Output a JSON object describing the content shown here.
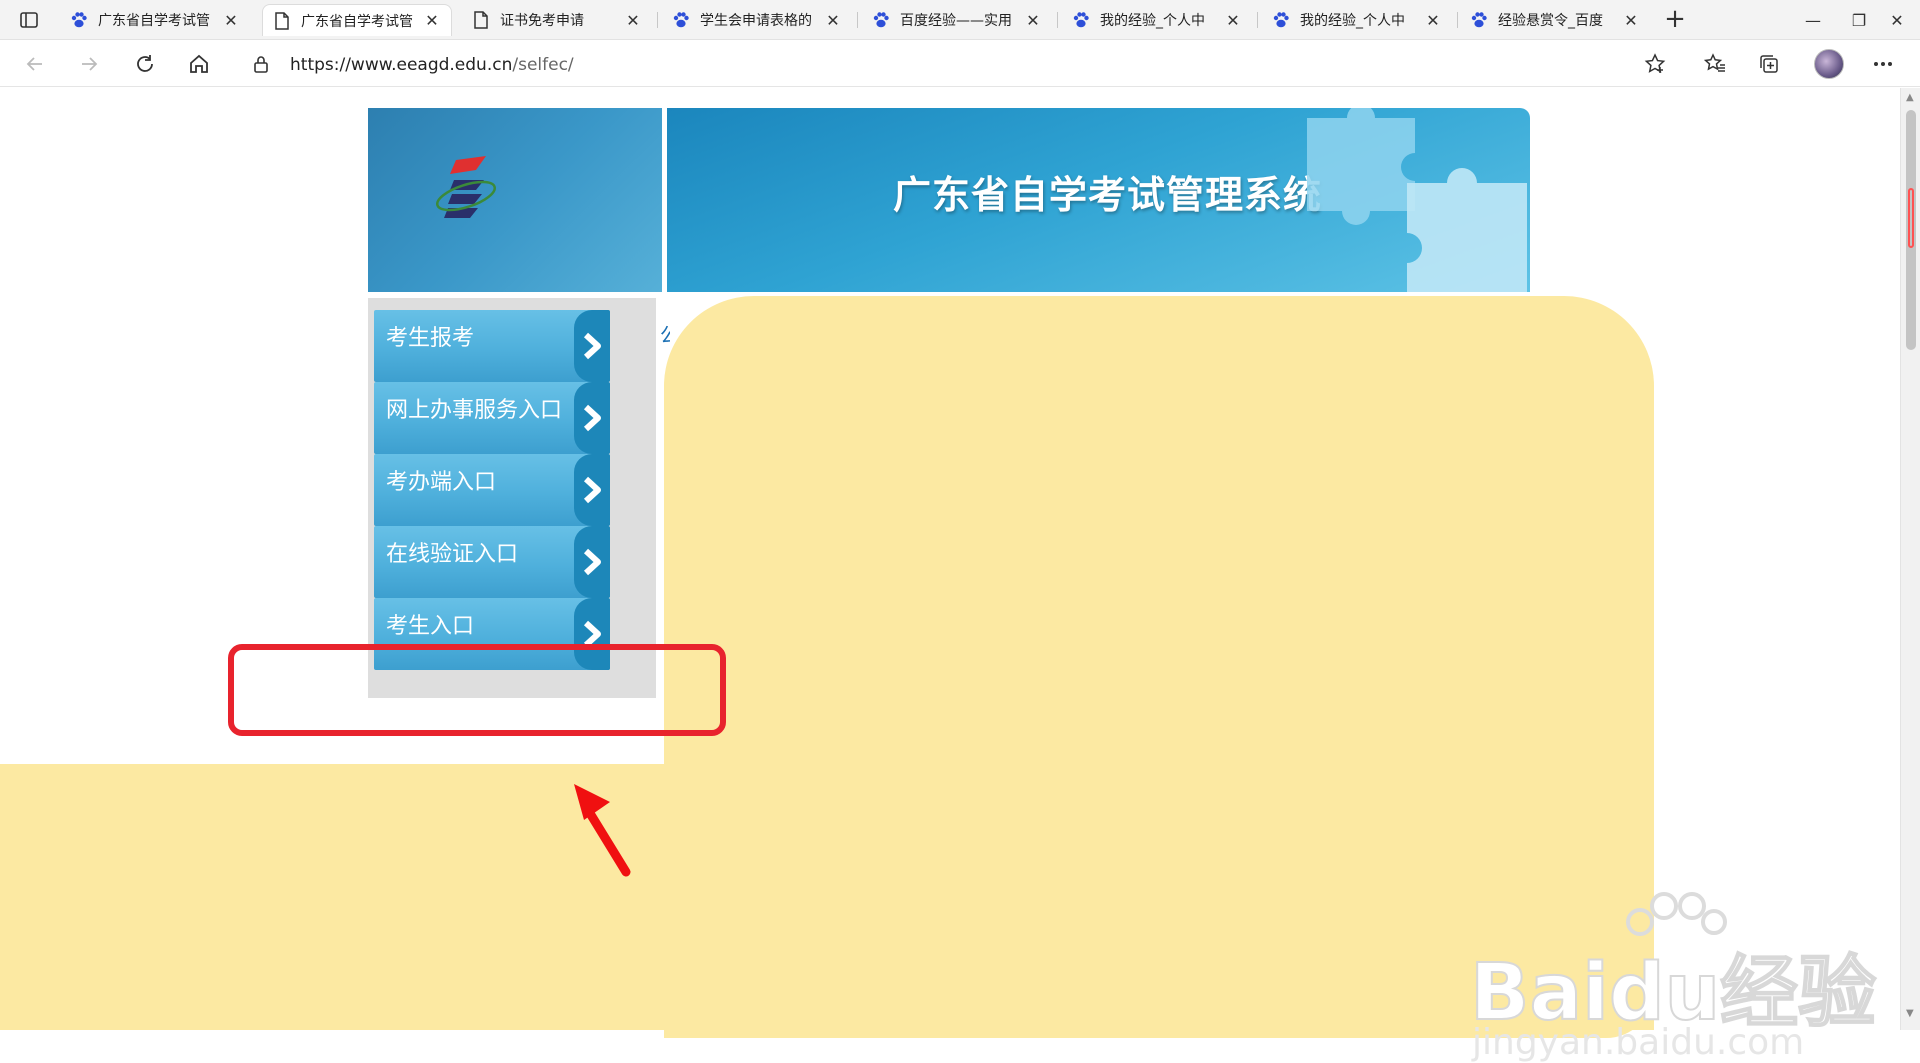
{
  "browser": {
    "tabs": [
      {
        "title": "广东省自学考试管",
        "icon": "baidu-paw-icon",
        "active": false
      },
      {
        "title": "广东省自学考试管",
        "icon": "page-icon",
        "active": true
      },
      {
        "title": "证书免考申请",
        "icon": "page-icon",
        "active": false
      },
      {
        "title": "学生会申请表格的",
        "icon": "baidu-paw-icon",
        "active": false
      },
      {
        "title": "百度经验——实用",
        "icon": "baidu-paw-icon",
        "active": false
      },
      {
        "title": "我的经验_个人中",
        "icon": "baidu-paw-icon",
        "active": false
      },
      {
        "title": "我的经验_个人中",
        "icon": "baidu-paw-icon",
        "active": false
      },
      {
        "title": "经验悬赏令_百度",
        "icon": "baidu-paw-icon",
        "active": false
      }
    ],
    "new_tab": "+",
    "window": {
      "minimize": "—",
      "restore": "❐",
      "close": "✕"
    },
    "address": {
      "host": "https://www.eeagd.edu.cn",
      "path": "/selfec/"
    }
  },
  "site": {
    "title": "广东省自学考试管理系统",
    "menu": [
      {
        "label": "考生报考"
      },
      {
        "label": "网上办事服务入口"
      },
      {
        "label": "考办端入口"
      },
      {
        "label": "在线验证入口"
      },
      {
        "label": "考生入口"
      }
    ]
  },
  "watermark": {
    "brand": "Baidu经验",
    "url": "jingyan.baidu.com"
  },
  "colors": {
    "highlight": "#e8232d",
    "overlay": "#fce9a2",
    "menu": "#4fb0dc"
  }
}
